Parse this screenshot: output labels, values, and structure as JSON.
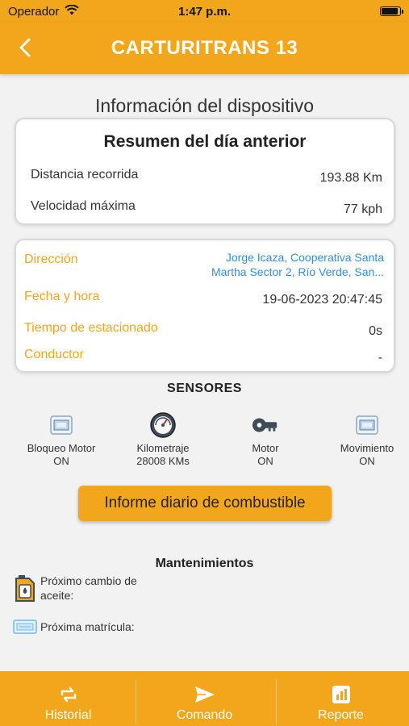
{
  "status_bar": {
    "carrier": "Operador",
    "time": "1:47 p.m."
  },
  "nav": {
    "title": "CARTURITRANS  13",
    "back_icon": "chevron-left-icon"
  },
  "page_title": "Información del dispositivo",
  "summary": {
    "title": "Resumen del día anterior",
    "rows": [
      {
        "label": "Distancia recorrida",
        "value": "193.88 Km"
      },
      {
        "label": "Velocidad máxima",
        "value": "77 kph"
      }
    ]
  },
  "details": {
    "direction_label": "Dirección",
    "direction_value": "Jorge Icaza, Cooperativa Santa Martha Sector 2, Río Verde, San...",
    "datetime_label": "Fecha y hora",
    "datetime_value": "19-06-2023 20:47:45",
    "parked_label": "Tiempo de estacionado",
    "parked_value": "0s",
    "driver_label": "Conductor",
    "driver_value": "-"
  },
  "sensors": {
    "title": "SENSORES",
    "items": [
      {
        "name": "Bloqueo Motor",
        "value": "ON",
        "icon": "engine-lock-icon"
      },
      {
        "name": "Kilometraje",
        "value": "28008 KMs",
        "icon": "odometer-icon"
      },
      {
        "name": "Motor",
        "value": "ON",
        "icon": "key-icon"
      },
      {
        "name": "Movimiento",
        "value": "ON",
        "icon": "movement-icon"
      }
    ]
  },
  "fuel_button": "Informe diario de combustible",
  "maintenance": {
    "title": "Mantenimientos",
    "oil": "Próximo cambio de aceite:",
    "plate": "Próxima matrícula:"
  },
  "tabs": [
    {
      "label": "Historial",
      "icon": "history-icon"
    },
    {
      "label": "Comando",
      "icon": "send-icon"
    },
    {
      "label": "Reporte",
      "icon": "report-icon"
    }
  ],
  "colors": {
    "accent": "#f2a61c",
    "link": "#2f8fdf"
  }
}
